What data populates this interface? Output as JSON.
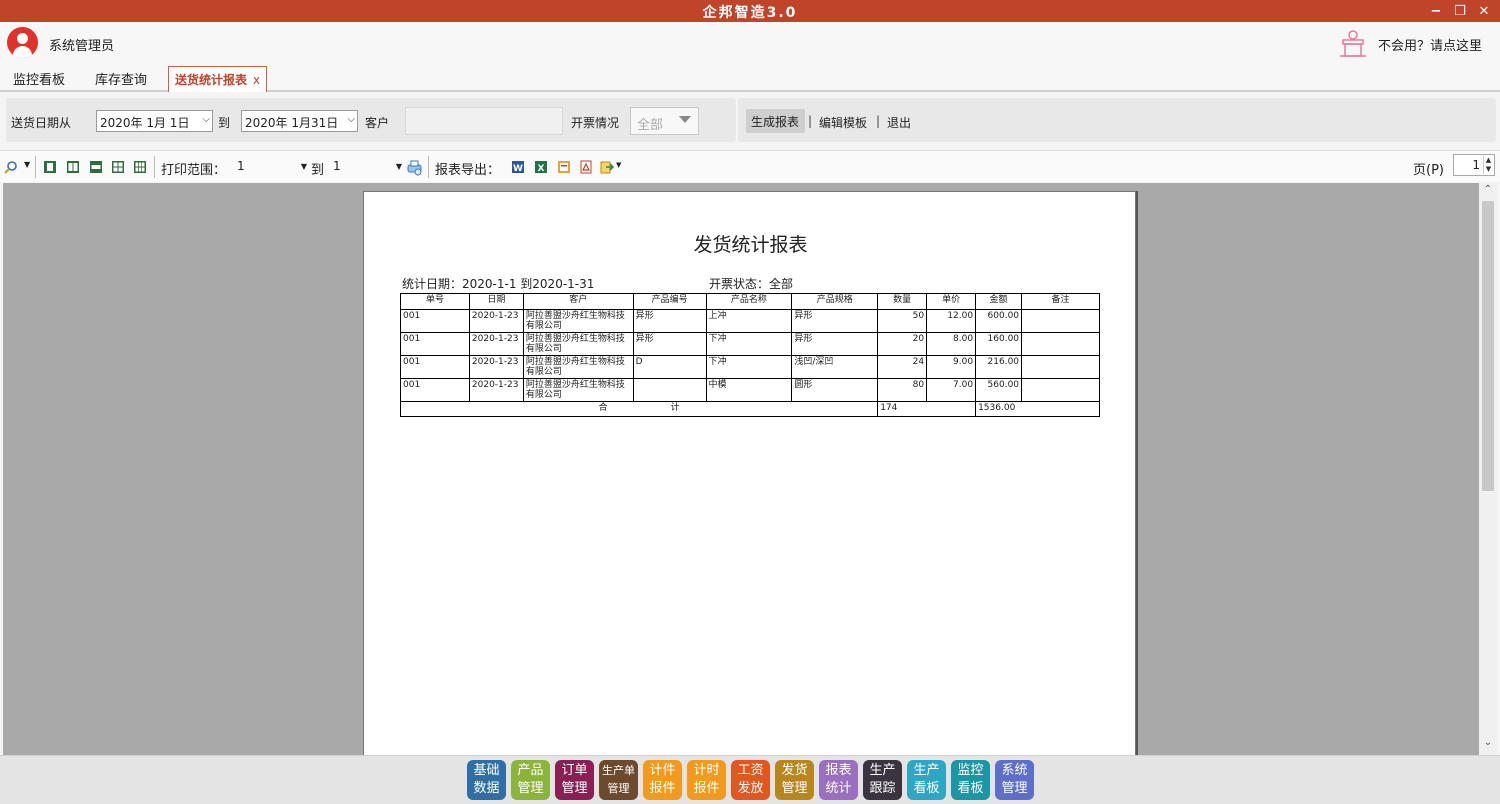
{
  "app": {
    "title": "企邦智造3.0",
    "win_min": "−",
    "win_max": "❐",
    "win_close": "✕"
  },
  "user": {
    "name": "系统管理员",
    "help": "不会用？请点这里"
  },
  "tabs": [
    {
      "label": "监控看板"
    },
    {
      "label": "库存查询"
    },
    {
      "label": "送货统计报表",
      "close": "x"
    }
  ],
  "filter": {
    "date_from_label": "送货日期从",
    "date_from": "2020年  1月  1日",
    "to_label": "到",
    "date_to": "2020年  1月31日",
    "customer_label": "客户",
    "customer_value": "",
    "invoice_label": "开票情况",
    "invoice_value": "全部",
    "generate": "生成报表",
    "sep": "|",
    "edit_template": "编辑模板",
    "exit": "退出"
  },
  "preview_toolbar": {
    "print_range_label": "打印范围：",
    "range_from": "1",
    "range_to_label": "到",
    "range_to": "1",
    "export_label": "报表导出：",
    "page_label": "页(P)",
    "page_value": "1"
  },
  "report": {
    "title": "发货统计报表",
    "date_range": "统计日期：2020-1-1 到2020-1-31",
    "invoice_status": "开票状态：全部",
    "columns": [
      "单号",
      "日期",
      "客户",
      "产品编号",
      "产品名称",
      "产品规格",
      "数量",
      "单价",
      "金额",
      "备注"
    ],
    "rows": [
      [
        "001",
        "2020-1-23",
        "阿拉善盟沙舟红生物科技有限公司",
        "异形",
        "上冲",
        "异形",
        "50",
        "12.00",
        "600.00",
        ""
      ],
      [
        "001",
        "2020-1-23",
        "阿拉善盟沙舟红生物科技有限公司",
        "异形",
        "下冲",
        "异形",
        "20",
        "8.00",
        "160.00",
        ""
      ],
      [
        "001",
        "2020-1-23",
        "阿拉善盟沙舟红生物科技有限公司",
        "D",
        "下冲",
        "浅凹/深凹",
        "24",
        "9.00",
        "216.00",
        ""
      ],
      [
        "001",
        "2020-1-23",
        "阿拉善盟沙舟红生物科技有限公司",
        "",
        "中模",
        "圆形",
        "80",
        "7.00",
        "560.00",
        ""
      ]
    ],
    "total_label": "合　　　　　　　计",
    "total_qty": "174",
    "total_amount": "1536.00"
  },
  "dock": [
    {
      "line1": "基础",
      "line2": "数据",
      "color": "#2f6fa4"
    },
    {
      "line1": "产品",
      "line2": "管理",
      "color": "#8cb43c"
    },
    {
      "line1": "订单",
      "line2": "管理",
      "color": "#8a1f56"
    },
    {
      "line1": "生产单",
      "line2": "管理",
      "color": "#6d4a2e"
    },
    {
      "line1": "计件",
      "line2": "报件",
      "color": "#f29a1e"
    },
    {
      "line1": "计时",
      "line2": "报件",
      "color": "#f29a1e"
    },
    {
      "line1": "工资",
      "line2": "发放",
      "color": "#e0581f"
    },
    {
      "line1": "发货",
      "line2": "管理",
      "color": "#b8861c"
    },
    {
      "line1": "报表",
      "line2": "统计",
      "color": "#9b6fc0"
    },
    {
      "line1": "生产",
      "line2": "跟踪",
      "color": "#3b3340"
    },
    {
      "line1": "生产",
      "line2": "看板",
      "color": "#2da7c4"
    },
    {
      "line1": "监控",
      "line2": "看板",
      "color": "#1a96a6"
    },
    {
      "line1": "系统",
      "line2": "管理",
      "color": "#5d6fc8"
    }
  ]
}
